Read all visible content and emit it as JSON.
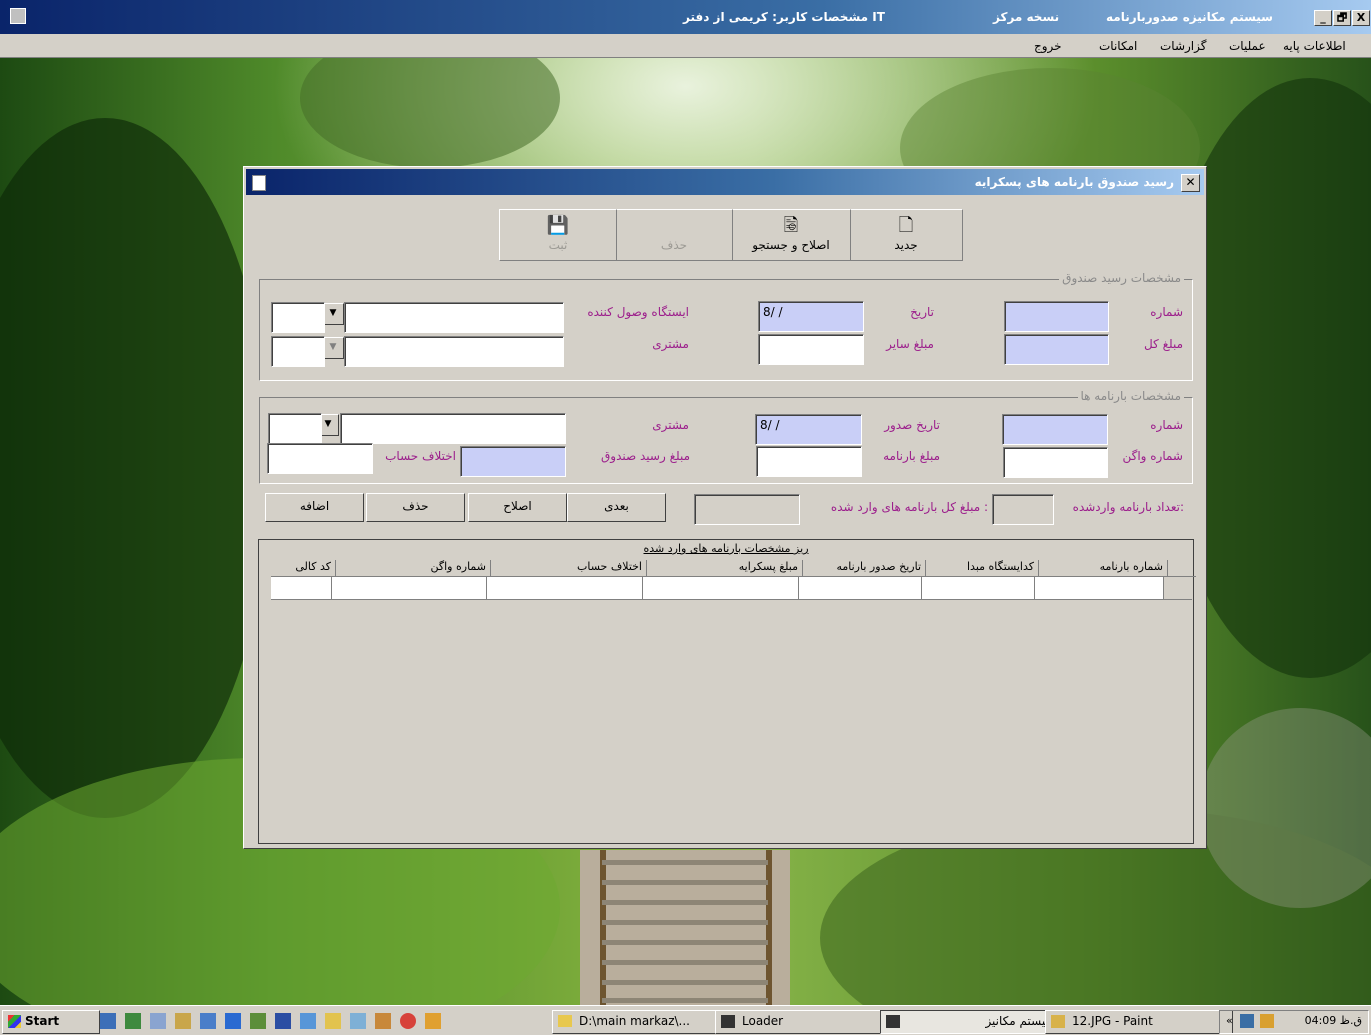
{
  "app_window": {
    "title_parts": [
      "سیستم مکانیزه صدوربارنامه",
      "نسخه مرکز",
      "مشخصات کاربر: کریمی از دفتر IT"
    ],
    "controls": [
      "_",
      "🗗",
      "X"
    ]
  },
  "menubar": [
    "اطلاعات پایه",
    "عملیات",
    "گزارشات",
    "امکانات",
    "خروج"
  ],
  "dialog": {
    "title": "رسید صندوق بارنامه های پسکرایه",
    "toolbar": [
      {
        "label": "جدید",
        "icon": "new-document-icon",
        "enabled": true
      },
      {
        "label": "اصلاح و جستجو",
        "icon": "search-document-icon",
        "enabled": true
      },
      {
        "label": "حذف",
        "icon": "none",
        "enabled": false
      },
      {
        "label": "ثبت",
        "icon": "save-icon",
        "enabled": false
      }
    ],
    "receipt_group": {
      "title": "مشخصات رسید صندوق",
      "number_label": "شماره",
      "number_value": "",
      "date_label": "تاریخ",
      "date_value": "8/ /",
      "station_label": "ایستگاه وصول کننده",
      "station_value": "",
      "total_label": "مبلغ کل",
      "total_value": "",
      "other_label": "مبلغ سایر",
      "other_value": "",
      "customer_label": "مشتری",
      "customer_value": ""
    },
    "waybill_group": {
      "title": "مشخصات بارنامه ها",
      "number_label": "شماره",
      "number_value": "",
      "issue_date_label": "تاریخ صدور",
      "issue_date_value": "8/ /",
      "customer_label": "مشتری",
      "customer_value": "",
      "wagon_label": "شماره واگن",
      "wagon_value": "",
      "waybill_amount_label": "مبلغ بارنامه",
      "waybill_amount_value": "",
      "receipt_amount_label": "مبلغ رسید صندوق",
      "receipt_amount_value": "",
      "diff_label": "اختلاف حساب",
      "diff_value": ""
    },
    "count_label": "تعداد بارنامه واردشده:",
    "count_value": "",
    "sum_label": "مبلغ کل بارنامه های وارد شده :",
    "sum_value": "",
    "actions": [
      "بعدی",
      "اصلاح",
      "حذف",
      "اضافه"
    ],
    "grid": {
      "caption": "ریز مشخصات بارنامه های وارد شده",
      "columns": [
        "شماره بارنامه",
        "کدایستگاه مبدا",
        "تاریخ صدور بارنامه",
        "مبلغ پسکرایه",
        "اختلاف حساب",
        "شماره واگن",
        "کد کالی"
      ]
    }
  },
  "taskbar": {
    "start": "Start",
    "tasks": [
      "D:\\main markaz\\...",
      "Loader",
      "سیستم مکانیز...",
      "12.JPG - Paint"
    ],
    "clock": "04:09 ق.ظ"
  },
  "colors": {
    "title_dark": "#0a246a",
    "title_light": "#a6caf0",
    "label_purple": "#9c1e8c",
    "field_blue": "#c9cff7",
    "face": "#d4d0c8"
  }
}
